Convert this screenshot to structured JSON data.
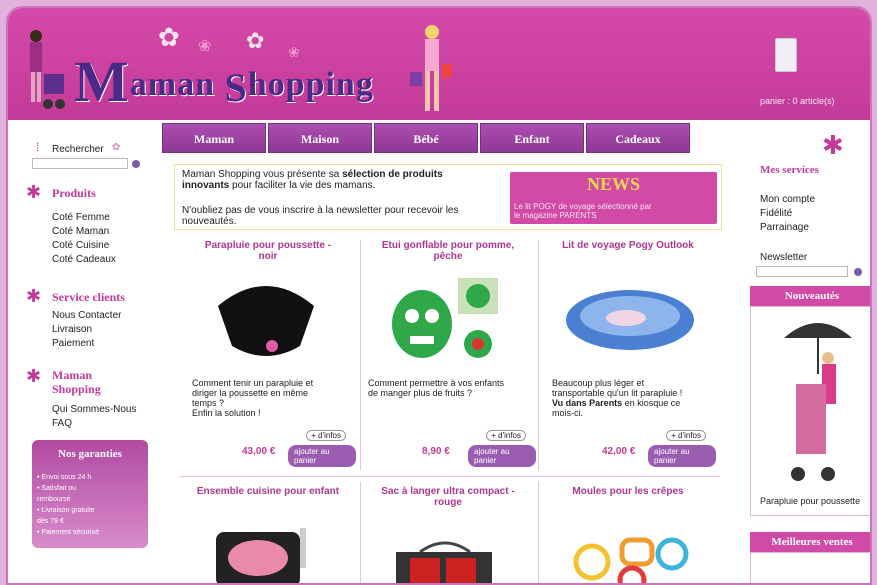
{
  "header": {
    "logo_text_m": "M",
    "logo_text_1": "aman ",
    "logo_text_s": "S",
    "logo_text_2": "hopping",
    "cart_text": "panier : 0 article(s)"
  },
  "search": {
    "label": "Rechercher"
  },
  "sidebar": {
    "produits_title": "Produits",
    "produits": [
      "Coté Femme",
      "Coté Maman",
      "Coté Cuisine",
      "Coté Cadeaux"
    ],
    "service_title": "Service clients",
    "service": [
      "Nous Contacter",
      "Livraison",
      "Paiement"
    ],
    "maman_title_1": "Maman",
    "maman_title_2": "Shopping",
    "maman": [
      "Qui Sommes-Nous",
      "FAQ"
    ],
    "garanties_title": "Nos garanties",
    "garanties": [
      "• Envoi sous 24 h",
      "• Satisfait ou",
      "remboursé",
      "• Livraison gratuite",
      "dès 79 €",
      "• Paiement sécurisé"
    ]
  },
  "nav": [
    "Maman",
    "Maison",
    "Bébé",
    "Enfant",
    "Cadeaux"
  ],
  "intro": {
    "line1a": "Maman Shopping vous présente sa ",
    "line1b": "sélection de produits",
    "line2a": "innovants",
    "line2b": " pour faciliter la vie des mamans.",
    "line3": "N'oubliez pas de vous inscrire à la newsletter pour recevoir les",
    "line4": "nouveautés."
  },
  "news": {
    "title": "NEWS",
    "text1": "Le lit POGY de voyage sélectionné par",
    "text2": "le magazine PARENTS"
  },
  "products": [
    {
      "name1": "Parapluie pour poussette -",
      "name2": "noir",
      "desc1": "Comment tenir un parapluie et",
      "desc2": "diriger la poussette en même",
      "desc3": "temps ?",
      "desc4": "Enfin la solution !",
      "infos": "+ d'infos",
      "price": "43,00 €",
      "add": "ajouter au panier"
    },
    {
      "name1": "Etui gonflable pour pomme,",
      "name2": "pêche",
      "desc1": "Comment permettre à vos enfants",
      "desc2": "de manger plus de fruits ?",
      "desc3": "",
      "desc4": "",
      "infos": "+ d'infos",
      "price": "8,90 €",
      "add": "ajouter au panier"
    },
    {
      "name1": "Lit de voyage Pogy Outlook",
      "name2": "",
      "desc1": "Beaucoup plus léger et",
      "desc2": "transportable qu'un lit parapluie !",
      "desc3b": "Vu dans Parents",
      "desc3c": " en kiosque ce",
      "desc4": "mois-ci.",
      "infos": "+ d'infos",
      "price": "42,00 €",
      "add": "ajouter au panier"
    },
    {
      "name1": "Ensemble cuisine pour enfant",
      "name2": ""
    },
    {
      "name1": "Sac à langer ultra compact -",
      "name2": "rouge"
    },
    {
      "name1": "Moules pour les crêpes",
      "name2": ""
    }
  ],
  "right": {
    "services_title": "Mes services",
    "services": [
      "Mon compte",
      "Fidélité",
      "Parrainage"
    ],
    "newsletter": "Newsletter",
    "nouveautes": "Nouveautés",
    "nouveaute_caption": "Parapluie pour poussette",
    "meilleures": "Meilleures ventes"
  }
}
